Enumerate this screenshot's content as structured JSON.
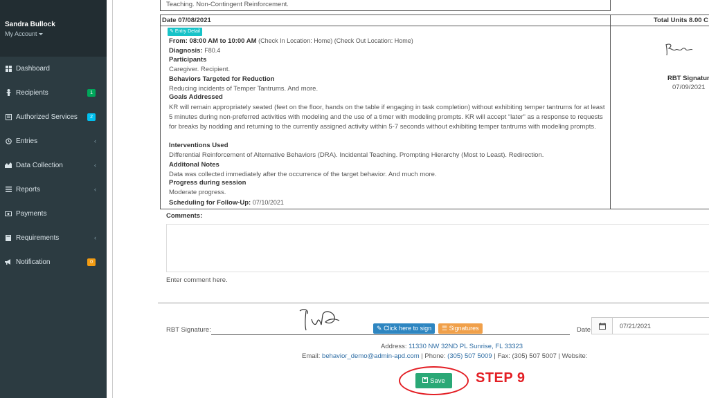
{
  "sidebar": {
    "user_name": "Sandra Bullock",
    "my_account": "My Account",
    "items": [
      {
        "label": "Dashboard",
        "icon": "dashboard-icon"
      },
      {
        "label": "Recipients",
        "icon": "recipients-icon",
        "badge": "1"
      },
      {
        "label": "Authorized Services",
        "icon": "services-icon",
        "badge": "2"
      },
      {
        "label": "Entries",
        "icon": "entries-icon",
        "chevron": "‹"
      },
      {
        "label": "Data Collection",
        "icon": "chart-icon",
        "chevron": "‹"
      },
      {
        "label": "Reports",
        "icon": "list-icon",
        "chevron": "‹"
      },
      {
        "label": "Payments",
        "icon": "money-icon"
      },
      {
        "label": "Requirements",
        "icon": "book-icon",
        "chevron": "‹"
      },
      {
        "label": "Notification",
        "icon": "bullhorn-icon",
        "badge": "0"
      }
    ]
  },
  "entry": {
    "top_text": "Teaching. Non-Contingent Reinforcement.",
    "date_header": "Date 07/08/2021",
    "total_units": "Total Units 8.00 C",
    "entry_detail_label": "Entry Detail",
    "from_label": "From: 08:00 AM to 10:00 AM",
    "from_rest": "(Check In Location: Home) (Check Out Location: Home)",
    "diagnosis_label": "Diagnosis:",
    "diagnosis_value": "F80.4",
    "participants_label": "Participants",
    "participants_value": "Caregiver. Recipient.",
    "behaviors_label": "Behaviors Targeted for Reduction",
    "behaviors_value": "Reducing incidents of Temper Tantrums. And more.",
    "goals_label": "Goals Addressed",
    "goals_value": "KR will remain appropriately seated (feet on the floor, hands on the table if engaging in task completion) without exhibiting temper tantrums for at least 5 minutes during non-preferred activities with modeling and the use of a timer with modeling prompts. KR will accept “later” as a response to requests for breaks by nodding and returning to the currently assigned activity within 5-7 seconds without exhibiting temper tantrums with modeling prompts.",
    "interventions_label": "Interventions Used",
    "interventions_value": "Differential Reinforcement of Alternative Behaviors (DRA). Incidental Teaching. Prompting Hierarchy (Most to Least). Redirection.",
    "additional_label": "Additonal Notes",
    "additional_value": "Data was collected immediately after the occurrence of the target behavior. And much more.",
    "progress_label": "Progress during session",
    "progress_value": "Moderate progress.",
    "followup_label": "Scheduling for Follow-Up:",
    "followup_value": "07/10/2021",
    "rbt_signature_label": "RBT Signature",
    "rbt_signature_date": "07/09/2021"
  },
  "comments": {
    "label": "Comments:",
    "placeholder": "Enter comment here."
  },
  "signature": {
    "rbt_label": "RBT Signature:",
    "click_to_sign": "Click here to sign",
    "signatures_btn": "Signatures",
    "date_label": "Date:",
    "date_value": "07/21/2021"
  },
  "footer": {
    "address_label": "Address:",
    "address_value": "11330 NW 32ND PL Sunrise, FL 33323",
    "email_label": "Email:",
    "email_value": "behavior_demo@admin-apd.com",
    "phone_label": "| Phone:",
    "phone_value": "(305) 507 5009",
    "fax_text": "| Fax: (305) 507 5007 | Website:"
  },
  "actions": {
    "save_label": "Save",
    "step_label": "STEP 9"
  },
  "colors": {
    "sidebar_bg": "#2c3b41",
    "save_green": "#2aa876",
    "step_red": "#e31e24",
    "entry_tag_teal": "#17c3c8"
  }
}
